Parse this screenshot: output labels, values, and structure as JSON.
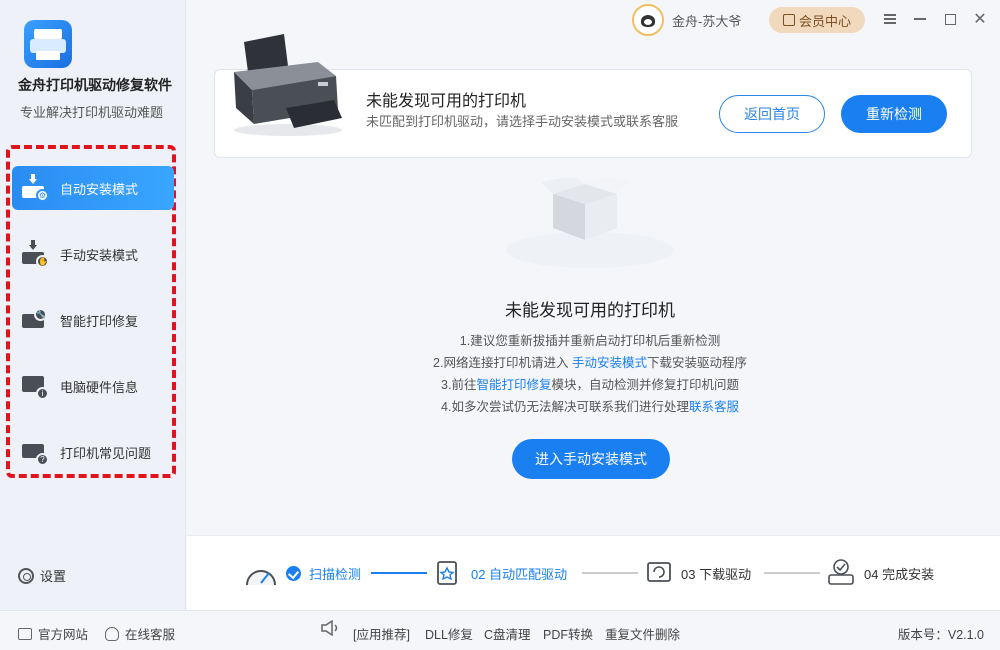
{
  "app": {
    "title": "金舟打印机驱动修复软件",
    "subtitle": "专业解决打印机驱动难题"
  },
  "sidebar": {
    "items": [
      {
        "label": "自动安装模式",
        "icon": "auto-install-icon",
        "active": true
      },
      {
        "label": "手动安装模式",
        "icon": "manual-install-icon",
        "active": false
      },
      {
        "label": "智能打印修复",
        "icon": "smart-repair-icon",
        "active": false
      },
      {
        "label": "电脑硬件信息",
        "icon": "hardware-info-icon",
        "active": false
      },
      {
        "label": "打印机常见问题",
        "icon": "faq-icon",
        "active": false
      }
    ],
    "settings_label": "设置"
  },
  "topbar": {
    "user_name": "金舟-苏大爷",
    "member_label": "会员中心"
  },
  "banner": {
    "title": "未能发现可用的打印机",
    "desc": "未匹配到打印机驱动，请选择手动安装模式或联系客服",
    "back_label": "返回首页",
    "recheck_label": "重新检测"
  },
  "empty": {
    "title": "未能发现可用的打印机",
    "tip1": "1.建议您重新拔插并重新启动打印机后重新检测",
    "tip2_a": "2.网络连接打印机请进入 ",
    "tip2_link": "手动安装模式",
    "tip2_b": "下载安装驱动程序",
    "tip3_a": "3.前往",
    "tip3_link": "智能打印修复",
    "tip3_b": "模块，自动检测并修复打印机问题",
    "tip4_a": "4.如多次尝试仍无法解决可联系我们进行处理",
    "tip4_link": "联系客服",
    "cta_label": "进入手动安装模式"
  },
  "steps": [
    {
      "label": "扫描检测",
      "state": "done"
    },
    {
      "label": "02 自动匹配驱动",
      "state": "current"
    },
    {
      "label": "03 下载驱动",
      "state": "pending"
    },
    {
      "label": "04 完成安装",
      "state": "pending"
    }
  ],
  "footer": {
    "official_site": "官方网站",
    "online_service": "在线客服",
    "recommend": "[应用推荐]",
    "links": [
      "DLL修复",
      "C盘清理",
      "PDF转换",
      "重复文件删除"
    ],
    "version": "版本号：V2.1.0"
  },
  "colors": {
    "accent": "#1a7ff0",
    "highlight_border": "#e0141c",
    "member_bg": "#f0d9bd"
  }
}
